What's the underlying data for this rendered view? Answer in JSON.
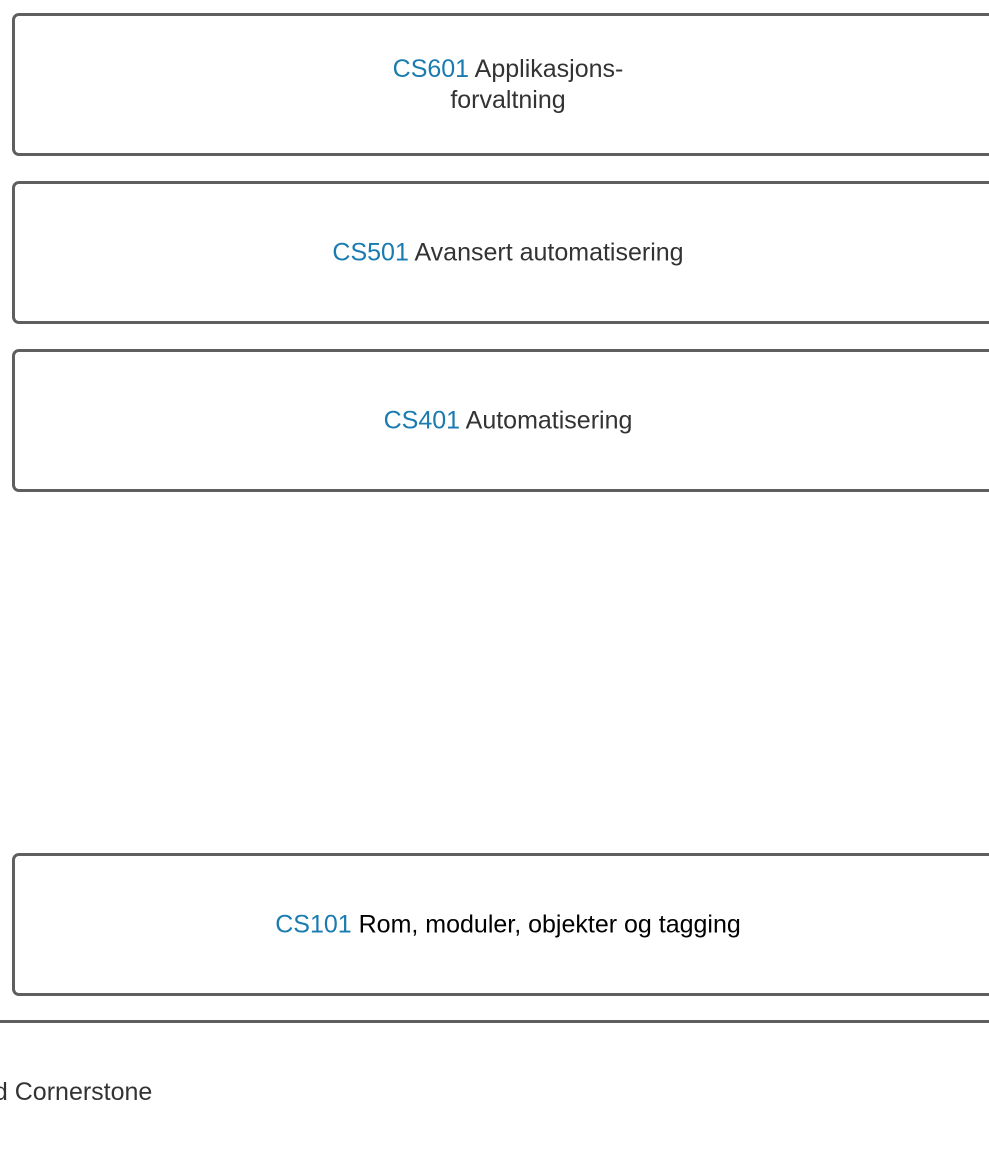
{
  "courses": [
    {
      "code": "CS601",
      "name": "Applikasjons-forvaltning",
      "name_line1": "Applikasjons-",
      "name_line2": "forvaltning"
    },
    {
      "code": "CS501",
      "name": "Avansert automatisering"
    },
    {
      "code": "CS401",
      "name": "Automatisering"
    },
    {
      "code": "CS101",
      "name": "Rom, moduler, objekter og tagging"
    }
  ],
  "footer": {
    "label": "ed Cornerstone"
  },
  "colors": {
    "code": "#1a7bb0",
    "text": "#333333",
    "border": "#5f5f5f"
  }
}
